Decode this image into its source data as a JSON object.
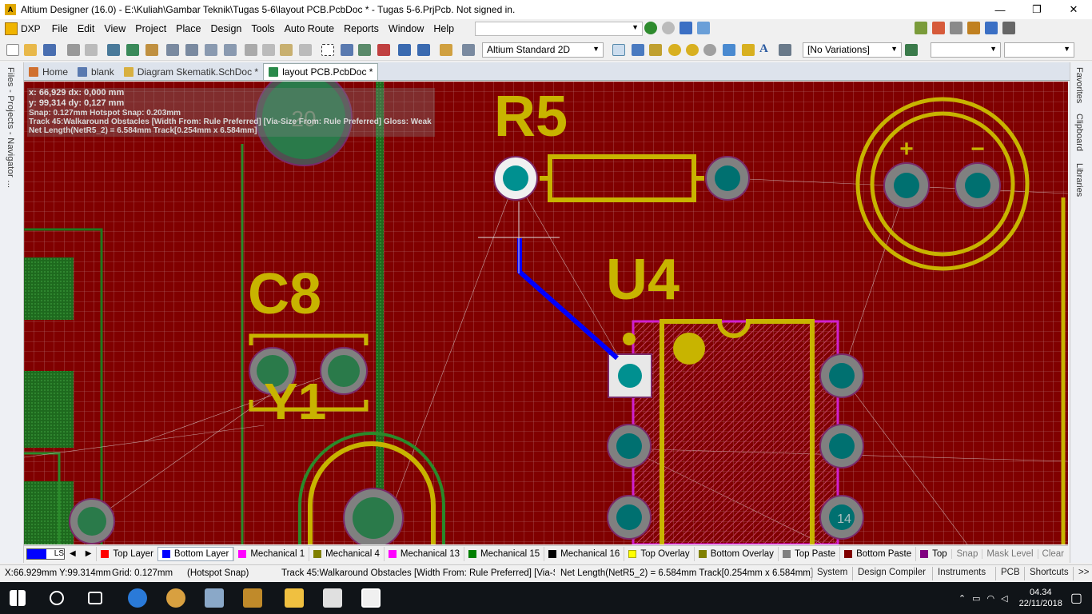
{
  "window": {
    "title": "Altium Designer (16.0) - E:\\Kuliah\\Gambar Teknik\\Tugas 5-6\\layout PCB.PcbDoc * - Tugas 5-6.PrjPcb. Not signed in.",
    "minimize": "—",
    "maximize": "❐",
    "close": "✕"
  },
  "menu": {
    "items": [
      "DXP",
      "File",
      "Edit",
      "View",
      "Project",
      "Place",
      "Design",
      "Tools",
      "Auto Route",
      "Reports",
      "Window",
      "Help"
    ]
  },
  "toolbar": {
    "view_mode": "Altium Standard 2D",
    "variations": "[No Variations]"
  },
  "left_panel": {
    "label": "Files - Projects - Navigator ..."
  },
  "right_panel": {
    "tabs": [
      "Favorites",
      "Clipboard",
      "Libraries"
    ]
  },
  "tabs": [
    {
      "label": "Home",
      "icon": "home-icon"
    },
    {
      "label": "blank",
      "icon": "document-icon"
    },
    {
      "label": "Diagram Skematik.SchDoc *",
      "icon": "schematic-icon"
    },
    {
      "label": "layout PCB.PcbDoc *",
      "icon": "pcb-icon",
      "active": true
    }
  ],
  "hud": {
    "line1": "x: 66,929   dx:  0,000 mm",
    "line2": "y: 99,314   dy:  0,127 mm",
    "line3": "Snap: 0.127mm Hotspot Snap: 0.203mm",
    "line4": "Track 45:Walkaround Obstacles [Width From: Rule Preferred] [Via-Size From: Rule Preferred] Gloss: Weak",
    "line5": "Net Length(NetR5_2) = 6.584mm Track[0.254mm x 6.584mm]"
  },
  "pcb": {
    "designators": {
      "r5": "R5",
      "c8": "C8",
      "u4": "U4",
      "y1": "Y1"
    },
    "pad_label_20": "20",
    "pad_label_14": "14",
    "polarity_plus": "+",
    "polarity_minus": "−",
    "colors": {
      "board": "#800000",
      "overlay": "#c8b400",
      "pad_ring": "#808080",
      "pad_hole": "#007070",
      "bottom_track": "#0000ff",
      "mechanical": "#ff00ff",
      "copper_green": "#1e6a1e"
    }
  },
  "layer_bar": {
    "ls_label": "LS",
    "layers": [
      {
        "label": "Top Layer",
        "color": "#ff0000"
      },
      {
        "label": "Bottom Layer",
        "color": "#0000ff",
        "active": true
      },
      {
        "label": "Mechanical 1",
        "color": "#ff00ff"
      },
      {
        "label": "Mechanical 4",
        "color": "#808000"
      },
      {
        "label": "Mechanical 13",
        "color": "#ff00ff"
      },
      {
        "label": "Mechanical 15",
        "color": "#008000"
      },
      {
        "label": "Mechanical 16",
        "color": "#000000"
      },
      {
        "label": "Top Overlay",
        "color": "#ffff00"
      },
      {
        "label": "Bottom Overlay",
        "color": "#808000"
      },
      {
        "label": "Top Paste",
        "color": "#808080"
      },
      {
        "label": "Bottom Paste",
        "color": "#800000"
      },
      {
        "label": "Top",
        "color": "#800080"
      }
    ],
    "right": [
      "Snap",
      "Mask Level",
      "Clear"
    ]
  },
  "status": {
    "coords": "X:66.929mm Y:99.314mm",
    "grid": "Grid: 0.127mm",
    "snap": "(Hotspot Snap)",
    "track": "Track 45:Walkaround Obstacles [Width From: Rule Preferred] [Via-S",
    "netlength": "Net Length(NetR5_2) = 6.584mm Track[0.254mm x 6.584mm]",
    "buttons": [
      "System",
      "Design Compiler",
      "Instruments",
      "PCB",
      "Shortcuts",
      ">>"
    ]
  },
  "taskbar": {
    "time": "04.34",
    "date": "22/11/2018"
  }
}
